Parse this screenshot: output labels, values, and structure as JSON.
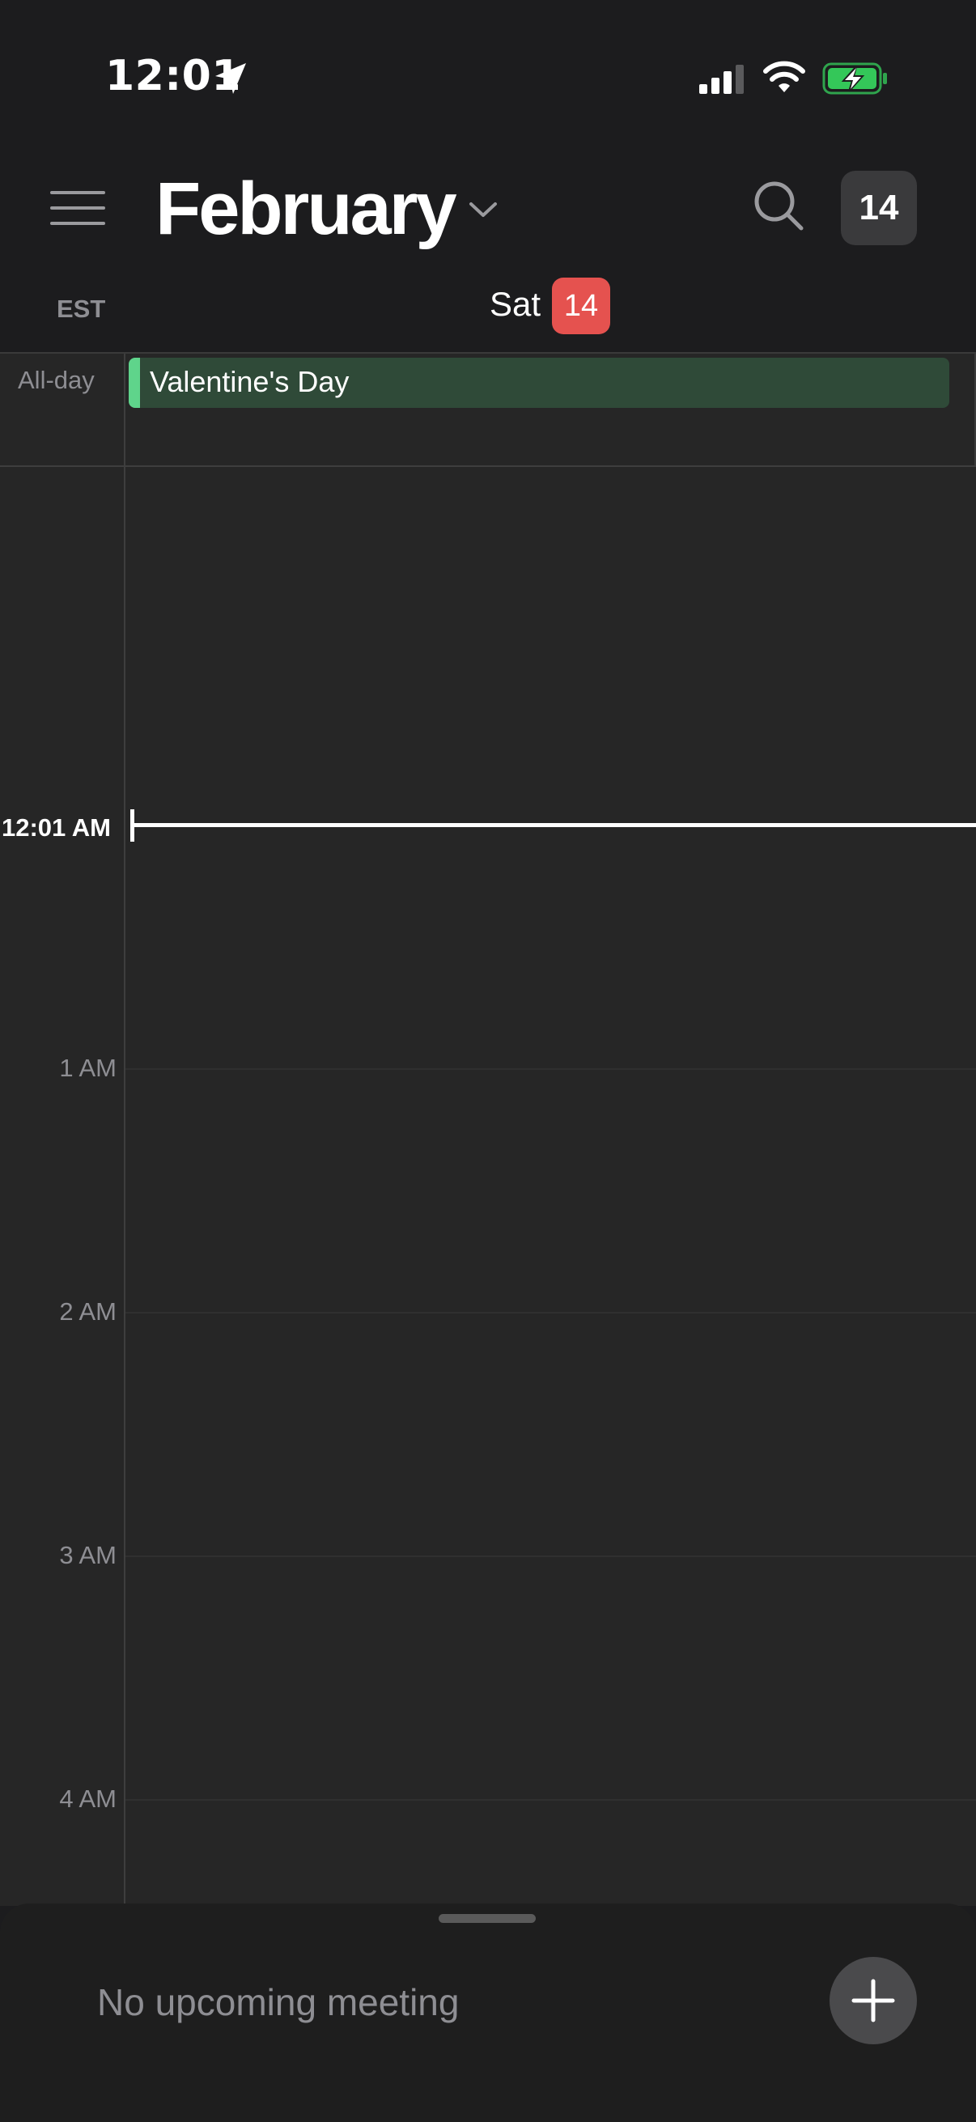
{
  "status_bar": {
    "time": "12:01",
    "icons": [
      "location-arrow-icon",
      "cellular-signal-icon",
      "wifi-icon",
      "battery-charging-icon"
    ],
    "battery_color": "#34c759"
  },
  "header": {
    "month": "February",
    "today_button": "14",
    "timezone": "EST",
    "day_name": "Sat",
    "day_number": "14",
    "accent_color": "#e5524f"
  },
  "all_day": {
    "label": "All-day",
    "events": [
      {
        "title": "Valentine's Day",
        "color": "#5fd48b"
      }
    ]
  },
  "timeline": {
    "current_time_label": "12:01 AM",
    "hours": [
      "1 AM",
      "2 AM",
      "3 AM",
      "4 AM"
    ]
  },
  "bottom_sheet": {
    "message": "No upcoming meeting"
  }
}
